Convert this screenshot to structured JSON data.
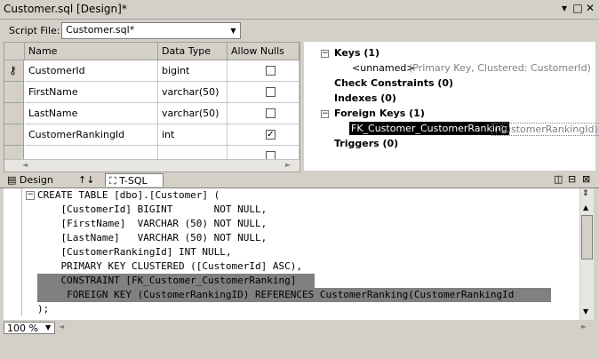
{
  "window": {
    "title": "Customer.sql [Design]*",
    "controls": [
      "▾",
      "□",
      "✕"
    ]
  },
  "toolbar": {
    "script_file_label": "Script File:",
    "script_file_value": "Customer.sql*"
  },
  "grid": {
    "headers": [
      "Name",
      "Data Type",
      "Allow Nulls"
    ],
    "rows": [
      {
        "name": "CustomerId",
        "type": "bigint",
        "nulls": false,
        "pk": true
      },
      {
        "name": "FirstName",
        "type": "varchar(50)",
        "nulls": false,
        "pk": false
      },
      {
        "name": "LastName",
        "type": "varchar(50)",
        "nulls": false,
        "pk": false
      },
      {
        "name": "CustomerRankingId",
        "type": "int",
        "nulls": true,
        "pk": false
      }
    ]
  },
  "props": {
    "keys": "Keys (1)",
    "keys_item": "<unnamed>",
    "keys_item_desc": "(Primary Key, Clustered: CustomerId)",
    "check": "Check Constraints (0)",
    "indexes": "Indexes (0)",
    "fk": "Foreign Keys (1)",
    "fk_item": "FK_Customer_CustomerRanking",
    "fk_item_desc": "(CustomerRankingId)",
    "triggers": "Triggers (0)"
  },
  "tabs": {
    "design": "Design",
    "swap": "↑↓",
    "tsql": "T-SQL"
  },
  "editor": {
    "lines": [
      "CREATE TABLE [dbo].[Customer] (",
      "    [CustomerId] BIGINT       NOT NULL,",
      "    [FirstName]  VARCHAR (50) NOT NULL,",
      "    [LastName]   VARCHAR (50) NOT NULL,",
      "    [CustomerRankingId] INT NULL,",
      "    PRIMARY KEY CLUSTERED ([CustomerId] ASC),",
      "    CONSTRAINT [FK_Customer_CustomerRanking]",
      "     FOREIGN KEY (CustomerRankingID) REFERENCES CustomerRanking(CustomerRankingId",
      ");"
    ]
  },
  "status": {
    "zoom": "100 %"
  }
}
